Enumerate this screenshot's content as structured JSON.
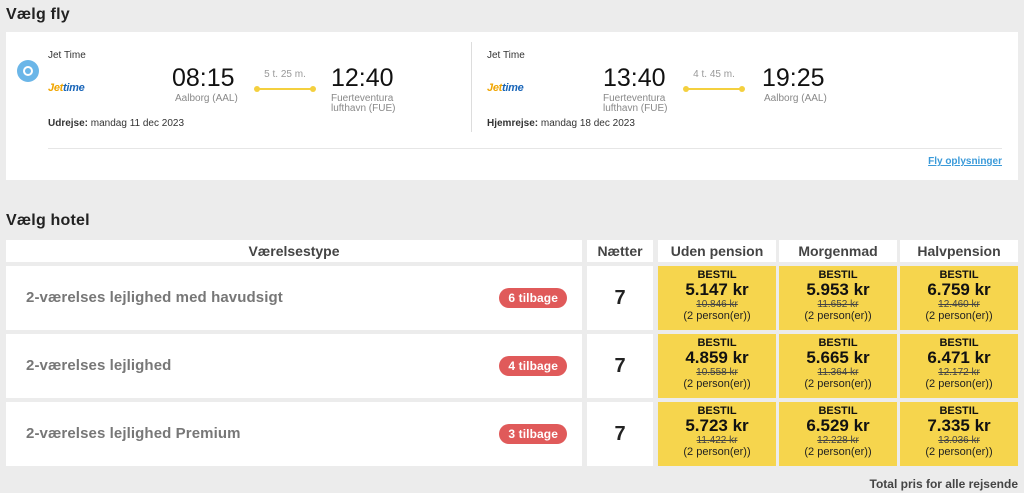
{
  "sections": {
    "flights_title": "Vælg fly",
    "hotel_title": "Vælg hotel"
  },
  "flights": {
    "outbound": {
      "airline": "Jet Time",
      "logo_a": "Jet",
      "logo_b": "time",
      "dep_time": "08:15",
      "dep_place": "Aalborg (AAL)",
      "duration": "5 t. 25 m.",
      "arr_time": "12:40",
      "arr_place_1": "Fuerteventura",
      "arr_place_2": "lufthavn (FUE)",
      "date_label": "Udrejse:",
      "date": " mandag 11 dec 2023"
    },
    "return": {
      "airline": "Jet Time",
      "logo_a": "Jet",
      "logo_b": "time",
      "dep_time": "13:40",
      "dep_place_1": "Fuerteventura",
      "dep_place_2": "lufthavn (FUE)",
      "duration": "4 t. 45 m.",
      "arr_time": "19:25",
      "arr_place": "Aalborg (AAL)",
      "date_label": "Hjemrejse:",
      "date": " mandag 18 dec 2023"
    },
    "info_link": "Fly oplysninger"
  },
  "hotel": {
    "headers": {
      "room": "Værelsestype",
      "nights": "Nætter",
      "col1": "Uden pension",
      "col2": "Morgenmad",
      "col3": "Halvpension"
    },
    "rows": [
      {
        "name": "2-værelses lejlighed med havudsigt",
        "badge": "6 tilbage",
        "nights": "7",
        "prices": [
          {
            "cta": "BESTIL",
            "price": "5.147 kr",
            "old": "10.846 kr",
            "persons": "(2 person(er))"
          },
          {
            "cta": "BESTIL",
            "price": "5.953 kr",
            "old": "11.652 kr",
            "persons": "(2 person(er))"
          },
          {
            "cta": "BESTIL",
            "price": "6.759 kr",
            "old": "12.460 kr",
            "persons": "(2 person(er))"
          }
        ]
      },
      {
        "name": "2-værelses lejlighed",
        "badge": "4 tilbage",
        "nights": "7",
        "prices": [
          {
            "cta": "BESTIL",
            "price": "4.859 kr",
            "old": "10.558 kr",
            "persons": "(2 person(er))"
          },
          {
            "cta": "BESTIL",
            "price": "5.665 kr",
            "old": "11.364 kr",
            "persons": "(2 person(er))"
          },
          {
            "cta": "BESTIL",
            "price": "6.471 kr",
            "old": "12.172 kr",
            "persons": "(2 person(er))"
          }
        ]
      },
      {
        "name": "2-værelses lejlighed Premium",
        "badge": "3 tilbage",
        "nights": "7",
        "prices": [
          {
            "cta": "BESTIL",
            "price": "5.723 kr",
            "old": "11.422 kr",
            "persons": "(2 person(er))"
          },
          {
            "cta": "BESTIL",
            "price": "6.529 kr",
            "old": "12.228 kr",
            "persons": "(2 person(er))"
          },
          {
            "cta": "BESTIL",
            "price": "7.335 kr",
            "old": "13.036 kr",
            "persons": "(2 person(er))"
          }
        ]
      }
    ],
    "footer_note": "Total pris for alle rejsende"
  },
  "colors": {
    "price_bg": "#f6d54d",
    "badge": "#e05a5a",
    "link": "#3a9ad9",
    "radio": "#6bb6e8"
  }
}
